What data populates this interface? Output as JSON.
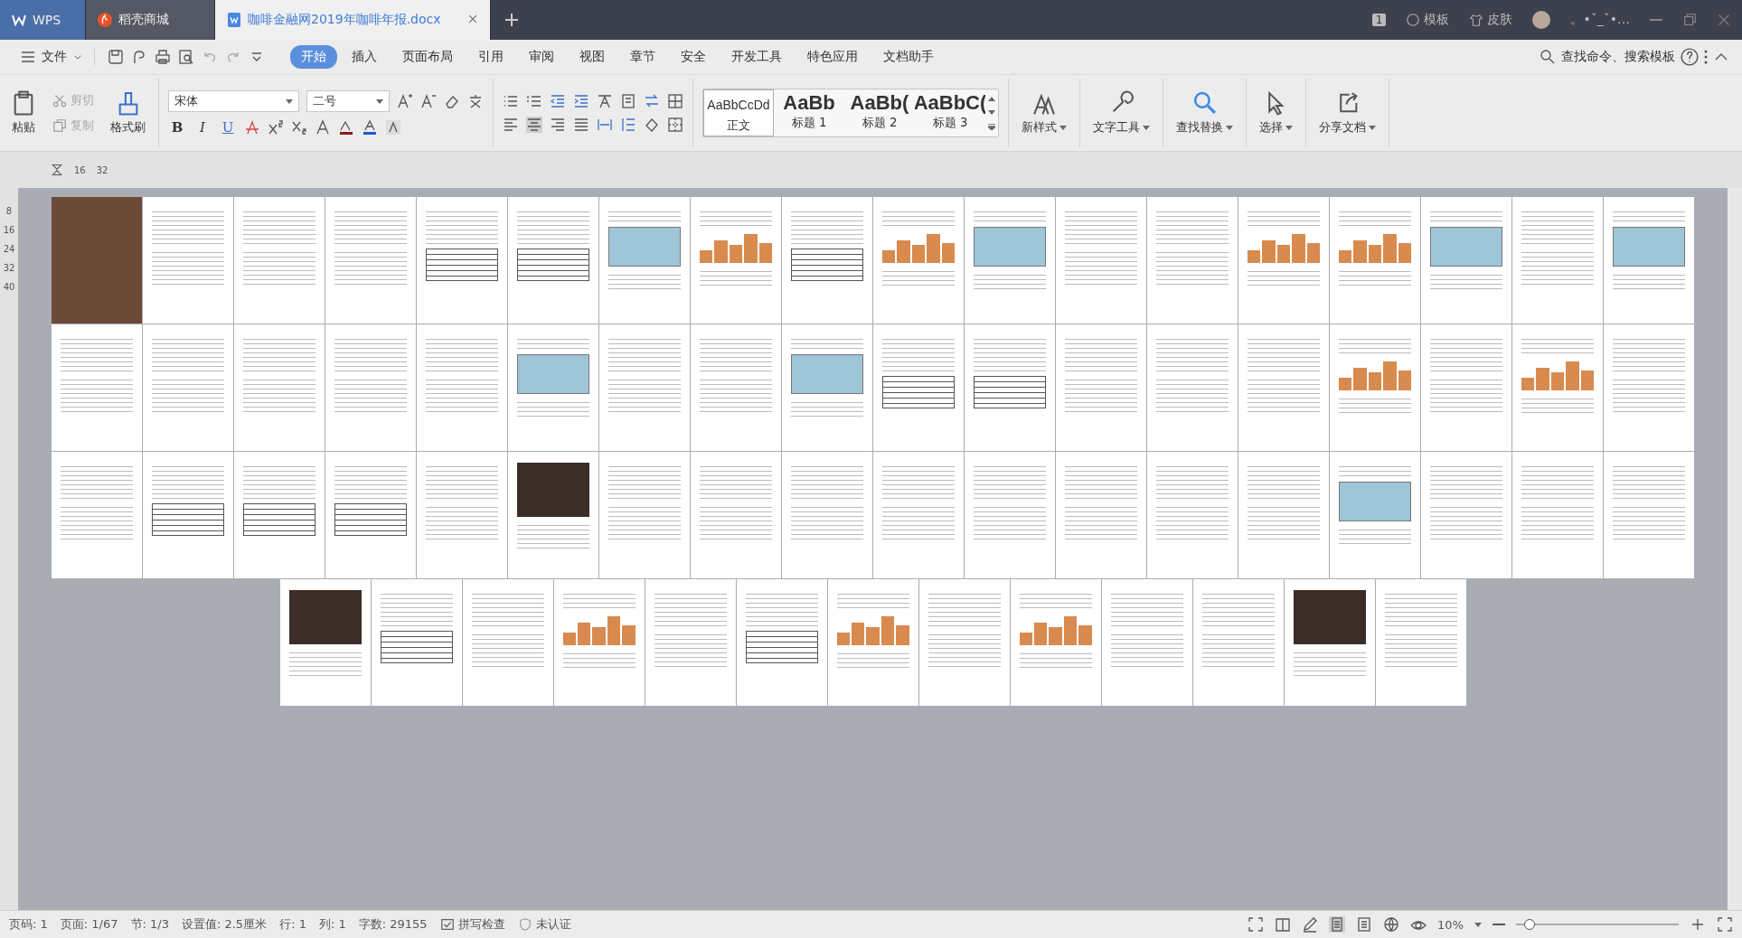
{
  "title_bar": {
    "tabs": [
      {
        "label": "WPS",
        "kind": "home",
        "selected": false
      },
      {
        "label": "稻壳商城",
        "kind": "store",
        "selected": false
      },
      {
        "label": "咖啡金融网2019年咖啡年报.docx",
        "kind": "document",
        "selected": true
      }
    ],
    "badge": "1",
    "actions": [
      "模板",
      "皮肤"
    ],
    "user": "。•ˇ_ˇ•…"
  },
  "menu_bar": {
    "file": "文件",
    "tabs": [
      {
        "label": "开始",
        "selected": true
      },
      {
        "label": "插入",
        "selected": false
      },
      {
        "label": "页面布局",
        "selected": false
      },
      {
        "label": "引用",
        "selected": false
      },
      {
        "label": "审阅",
        "selected": false
      },
      {
        "label": "视图",
        "selected": false
      },
      {
        "label": "章节",
        "selected": false
      },
      {
        "label": "安全",
        "selected": false
      },
      {
        "label": "开发工具",
        "selected": false
      },
      {
        "label": "特色应用",
        "selected": false
      },
      {
        "label": "文档助手",
        "selected": false
      }
    ],
    "search": "查找命令、搜索模板"
  },
  "ribbon": {
    "paste": "粘贴",
    "cut": {
      "label": "剪切",
      "disabled": true
    },
    "copy": {
      "label": "复制",
      "disabled": true
    },
    "format_painter": "格式刷",
    "font": {
      "name": "宋体",
      "size": "二号"
    },
    "format_buttons": [
      "B",
      "I",
      "U"
    ],
    "styles": [
      {
        "preview": "AaBbCcDd",
        "label": "正文",
        "selected": true
      },
      {
        "preview": "AaBb",
        "label": "标题 1",
        "selected": false
      },
      {
        "preview": "AaBb(",
        "label": "标题 2",
        "selected": false
      },
      {
        "preview": "AaBbC(",
        "label": "标题 3",
        "selected": false
      }
    ],
    "tools": [
      {
        "label": "新样式",
        "kind": "style"
      },
      {
        "label": "文字工具",
        "kind": "wrench"
      },
      {
        "label": "查找替换",
        "kind": "search"
      },
      {
        "label": "选择",
        "kind": "cursor"
      },
      {
        "label": "分享文档",
        "kind": "share"
      }
    ]
  },
  "ruler": {
    "marks": [
      "16",
      "32"
    ],
    "vertical_marks": [
      "8",
      "16",
      "24",
      "32",
      "40"
    ]
  },
  "document": {
    "rows": [
      {
        "pages": [
          {
            "kind": "cover"
          },
          {
            "kind": "text"
          },
          {
            "kind": "text"
          },
          {
            "kind": "text"
          },
          {
            "kind": "table"
          },
          {
            "kind": "table"
          },
          {
            "kind": "map"
          },
          {
            "kind": "chart"
          },
          {
            "kind": "table"
          },
          {
            "kind": "chart"
          },
          {
            "kind": "map"
          },
          {
            "kind": "text"
          },
          {
            "kind": "text"
          },
          {
            "kind": "chart"
          },
          {
            "kind": "chart"
          },
          {
            "kind": "map"
          },
          {
            "kind": "text"
          },
          {
            "kind": "map"
          }
        ]
      },
      {
        "pages": [
          {
            "kind": "text"
          },
          {
            "kind": "text"
          },
          {
            "kind": "text"
          },
          {
            "kind": "text"
          },
          {
            "kind": "text"
          },
          {
            "kind": "map"
          },
          {
            "kind": "text"
          },
          {
            "kind": "text"
          },
          {
            "kind": "map"
          },
          {
            "kind": "table"
          },
          {
            "kind": "table"
          },
          {
            "kind": "text"
          },
          {
            "kind": "text"
          },
          {
            "kind": "text"
          },
          {
            "kind": "chart"
          },
          {
            "kind": "text"
          },
          {
            "kind": "chart"
          },
          {
            "kind": "text"
          }
        ]
      },
      {
        "pages": [
          {
            "kind": "text"
          },
          {
            "kind": "table"
          },
          {
            "kind": "table"
          },
          {
            "kind": "table"
          },
          {
            "kind": "text"
          },
          {
            "kind": "photo"
          },
          {
            "kind": "text"
          },
          {
            "kind": "text"
          },
          {
            "kind": "text"
          },
          {
            "kind": "text"
          },
          {
            "kind": "text"
          },
          {
            "kind": "text"
          },
          {
            "kind": "text"
          },
          {
            "kind": "text"
          },
          {
            "kind": "map"
          },
          {
            "kind": "text"
          },
          {
            "kind": "text"
          },
          {
            "kind": "text"
          }
        ]
      },
      {
        "pages": [
          {
            "kind": "photo"
          },
          {
            "kind": "table"
          },
          {
            "kind": "text"
          },
          {
            "kind": "chart"
          },
          {
            "kind": "text"
          },
          {
            "kind": "table"
          },
          {
            "kind": "chart"
          },
          {
            "kind": "text"
          },
          {
            "kind": "chart"
          },
          {
            "kind": "text"
          },
          {
            "kind": "text"
          },
          {
            "kind": "photo"
          },
          {
            "kind": "text"
          }
        ]
      }
    ]
  },
  "status_bar": {
    "items": [
      "页码: 1",
      "页面: 1/67",
      "节: 1/3",
      "设置值: 2.5厘米",
      "行: 1",
      "列: 1",
      "字数: 29155"
    ],
    "spell_check": "拼写检查",
    "certification": "未认证",
    "zoom": "10%",
    "zoom_level": {
      "level": 0.05
    }
  }
}
